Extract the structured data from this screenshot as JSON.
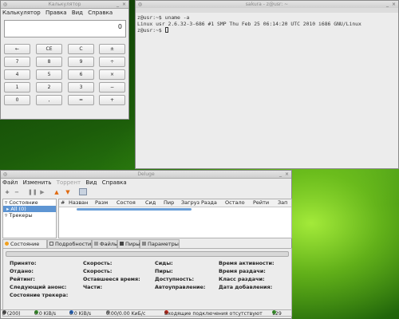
{
  "calculator": {
    "title": "Калькулятор",
    "menu": [
      "Калькулятор",
      "Правка",
      "Вид",
      "Справка"
    ],
    "display": "0",
    "buttons": [
      [
        "←",
        "CE",
        "C",
        "±"
      ],
      [
        "7",
        "8",
        "9",
        "÷"
      ],
      [
        "4",
        "5",
        "6",
        "×"
      ],
      [
        "1",
        "2",
        "3",
        "−"
      ],
      [
        "0",
        ",",
        "=",
        "+"
      ]
    ]
  },
  "terminal": {
    "title": "sakura - z@usr: ~",
    "lines": [
      "z@usr:~$ uname -a",
      "Linux usr 2.6.32-3-686 #1 SMP Thu Feb 25 06:14:20 UTC 2010 i686 GNU/Linux",
      "z@usr:~$ "
    ]
  },
  "deluge": {
    "title": "Deluge",
    "menu": [
      "Файл",
      "Изменить",
      "Торрент",
      "Вид",
      "Справка"
    ],
    "sidebar": {
      "state_header": "Состояние",
      "all_item": "All (0)",
      "trackers_header": "Трекеры"
    },
    "columns": [
      "#",
      "Назван",
      "Разм",
      "Состоя",
      "Сид",
      "Пир",
      "Загруз",
      "Разда",
      "Остало",
      "Рейти",
      "Зап"
    ],
    "tabs": [
      "Состояние",
      "Подробности",
      "Файлы",
      "Пиры",
      "Параметры"
    ],
    "status_fields": {
      "col1": [
        "Принято:",
        "Отдано:",
        "Рейтинг:",
        "Следующий анонс:",
        "Состояние трекера:"
      ],
      "col2": [
        "Скорость:",
        "Скорость:",
        "Оставшееся время:",
        "Части:"
      ],
      "col3": [
        "Сиды:",
        "Пиры:",
        "Доступность:",
        "Автоуправление:"
      ],
      "col4": [
        "Время активности:",
        "Время раздачи:",
        "Класс раздачи:",
        "Дата добавления:"
      ]
    },
    "statusbar": {
      "connections": "0 (200)",
      "download": "0.0 KiB/s",
      "upload": "0.0 KiB/s",
      "protocol": "0.00/0.00 KиБ/с",
      "incoming": "Входящие подключения отсутствуют",
      "dht": "129"
    }
  },
  "colors": {
    "selection": "#5e95d3",
    "window_bg": "#ececec",
    "desktop_green": "#2f7d0c"
  }
}
